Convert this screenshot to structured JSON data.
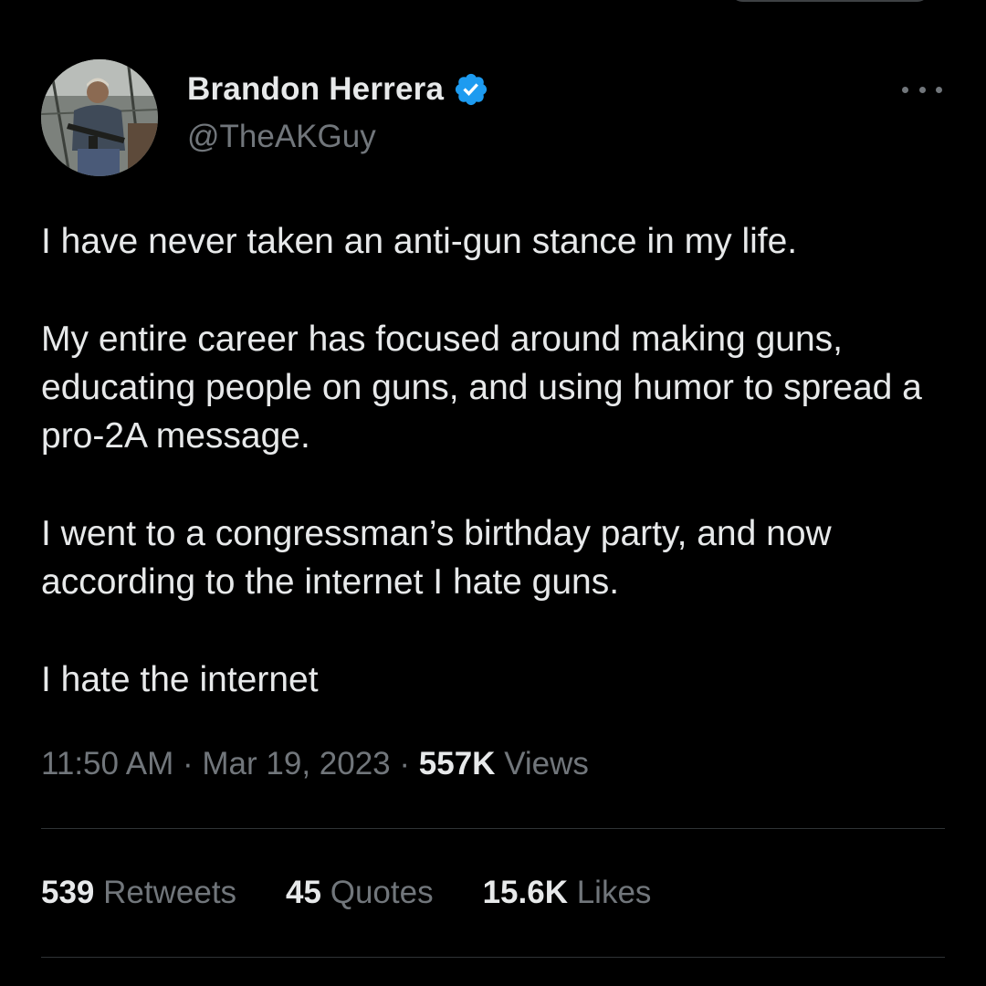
{
  "author": {
    "name": "Brandon Herrera",
    "handle": "@TheAKGuy",
    "verified_icon": "verified-badge-icon",
    "avatar_icon": "profile-photo"
  },
  "more_icon": "more-options-icon",
  "tweet": {
    "paragraphs": [
      "I have never taken an anti-gun stance in my life.",
      "My entire career has focused around making guns, educating people on guns, and using humor to spread a pro-2A message.",
      "I went to a congressman’s birthday party, and now according to the internet I hate guns.",
      "I hate the internet"
    ]
  },
  "meta": {
    "time": "11:50 AM",
    "separator": "·",
    "date": "Mar 19, 2023",
    "views_count": "557K",
    "views_label": "Views"
  },
  "stats": {
    "retweets_count": "539",
    "retweets_label": "Retweets",
    "quotes_count": "45",
    "quotes_label": "Quotes",
    "likes_count": "15.6K",
    "likes_label": "Likes"
  },
  "colors": {
    "background": "#000000",
    "text_primary": "#e7e9ea",
    "text_secondary": "#71767b",
    "verified_blue": "#1d9bf0",
    "divider": "#2f3336"
  }
}
